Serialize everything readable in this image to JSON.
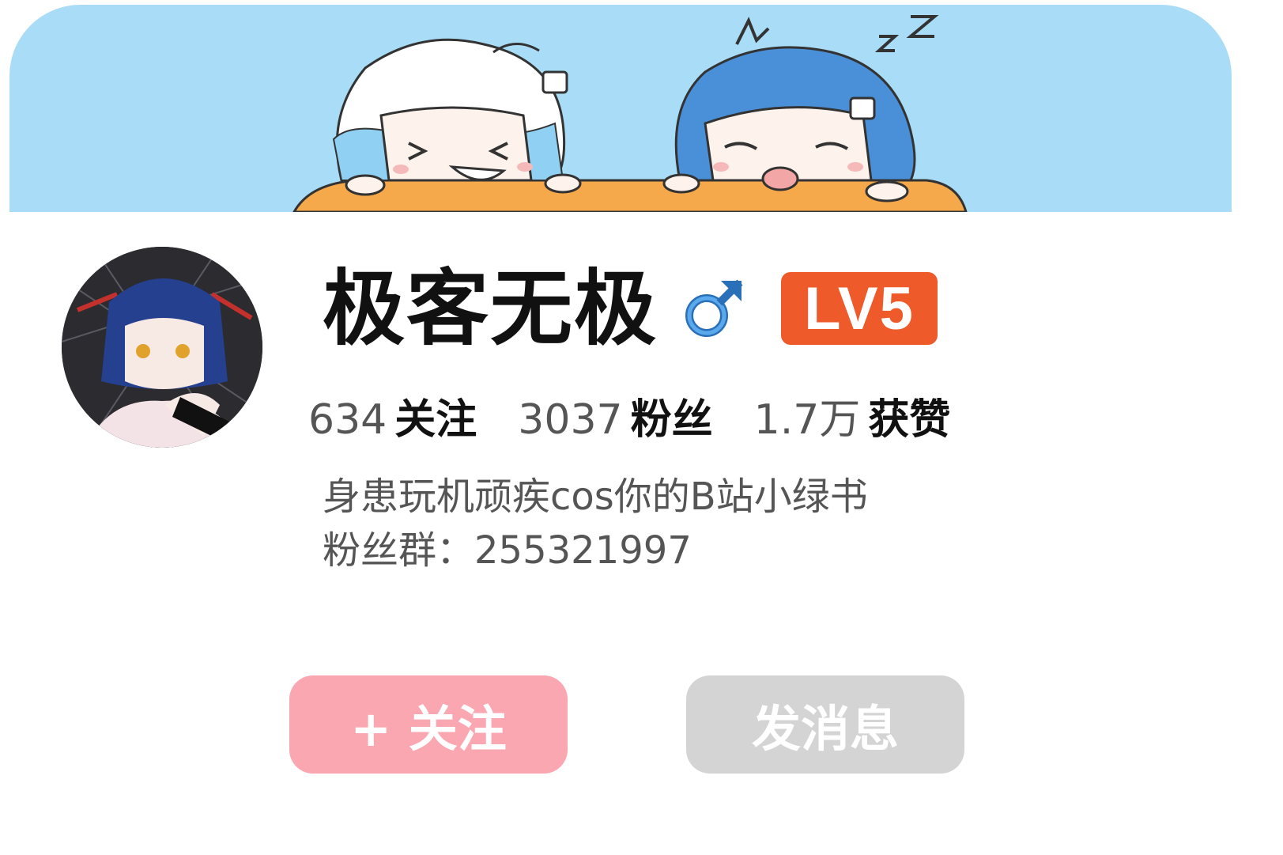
{
  "profile": {
    "username": "极客无极",
    "level": "LV5",
    "gender_icon": "male-symbol-icon",
    "level_color": "#ee5a2a",
    "gender_color": "#3d8fd6"
  },
  "stats": {
    "following_count": "634",
    "following_label": "关注",
    "followers_count": "3037",
    "followers_label": "粉丝",
    "likes_count": "1.7万",
    "likes_label": "获赞"
  },
  "bio": {
    "line1": "身患玩机顽疾cos你的B站小绿书",
    "line2": "粉丝群：255321997"
  },
  "actions": {
    "follow_label": "+ 关注",
    "message_label": "发消息",
    "follow_color": "#fba7b2",
    "message_color": "#d4d4d4"
  },
  "banner": {
    "background_color": "#a9dcf6"
  }
}
